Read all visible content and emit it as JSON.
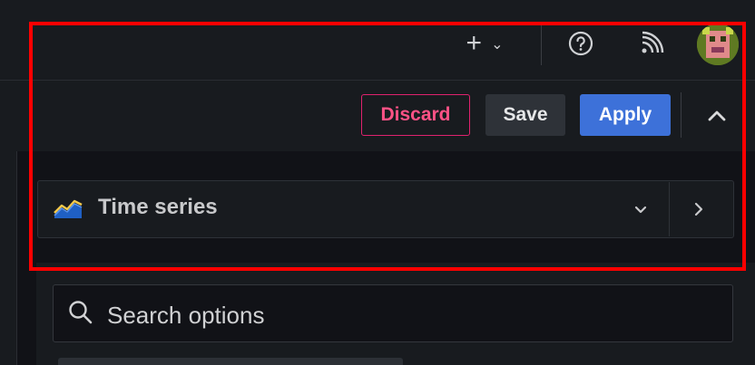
{
  "topbar": {
    "new_icon": "plus-icon",
    "new_caret_icon": "chevron-down-icon",
    "help_icon": "help-circle-icon",
    "news_icon": "rss-icon",
    "avatar_icon": "user-avatar"
  },
  "panel_toolbar": {
    "discard_label": "Discard",
    "save_label": "Save",
    "apply_label": "Apply",
    "collapse_icon": "chevron-up-icon"
  },
  "viz_picker": {
    "label": "Time series",
    "icon": "time-series-icon",
    "dropdown_icon": "chevron-down-icon",
    "next_icon": "chevron-right-icon"
  },
  "options": {
    "search_placeholder": "Search options",
    "search_value": ""
  },
  "colors": {
    "discard": "#ff5286",
    "apply": "#3d71d9",
    "highlight": "#ff0000"
  }
}
